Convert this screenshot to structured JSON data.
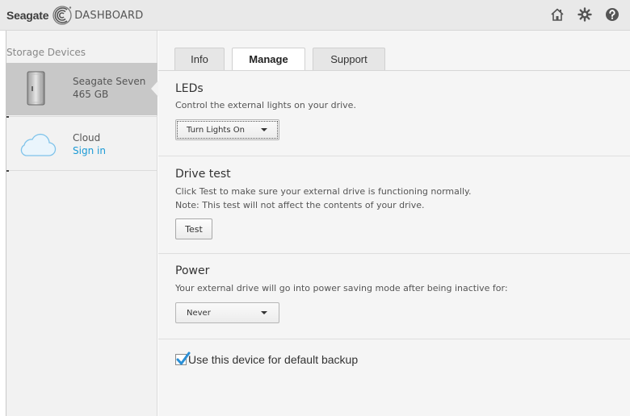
{
  "header": {
    "brand": "Seagate",
    "app_title": "DASHBOARD",
    "icons": [
      "home-icon",
      "gear-icon",
      "help-icon"
    ]
  },
  "sidebar": {
    "title": "Storage Devices",
    "devices": [
      {
        "name": "Seagate Seven",
        "detail": "465 GB",
        "icon": "drive-icon"
      },
      {
        "name": "Cloud",
        "link": "Sign in",
        "icon": "cloud-icon"
      }
    ]
  },
  "tabs": [
    {
      "label": "Info",
      "active": false
    },
    {
      "label": "Manage",
      "active": true
    },
    {
      "label": "Support",
      "active": false
    }
  ],
  "leds": {
    "title": "LEDs",
    "description": "Control the external lights on your drive.",
    "dropdown_value": "Turn Lights On"
  },
  "drive_test": {
    "title": "Drive test",
    "line1": "Click Test to make sure your external drive is functioning normally.",
    "line2": "Note: This test will not affect the contents of your drive.",
    "button": "Test"
  },
  "power": {
    "title": "Power",
    "description": "Your external drive will go into power saving mode after being inactive for:",
    "dropdown_value": "Never"
  },
  "backup": {
    "label": "Use this device for default backup",
    "checked": true
  },
  "colors": {
    "accent": "#1a9ad6",
    "check": "#2a8fd6",
    "selected_item": "#c8c8c8"
  }
}
